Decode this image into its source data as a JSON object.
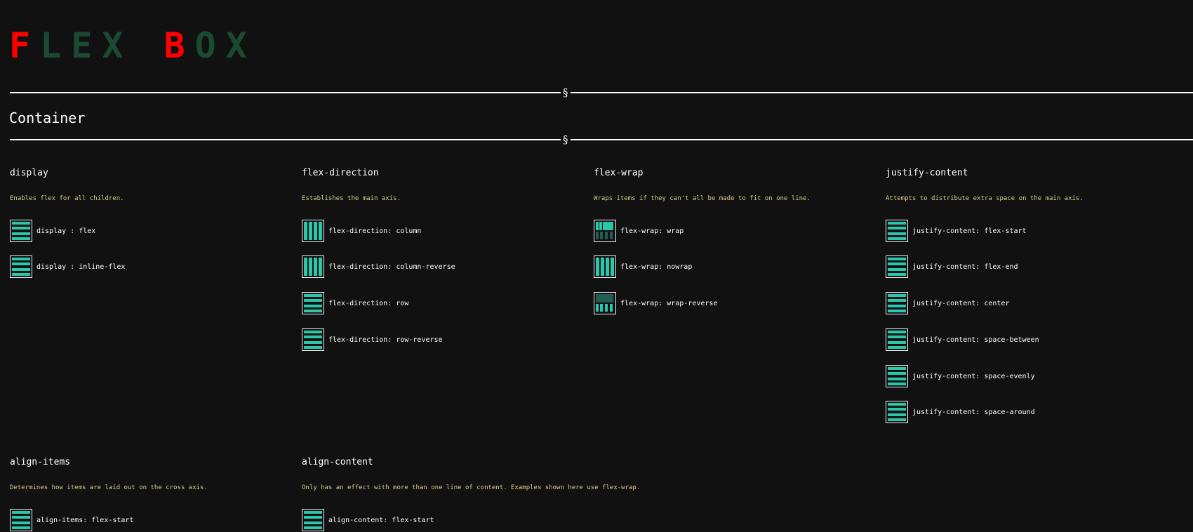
{
  "logo": {
    "f": "F",
    "lex": "LEX",
    "b": "B",
    "ox": "OX"
  },
  "section_mark": "§",
  "section_title": "Container",
  "accent_color": "#29c7ac",
  "logo_red": "#ff0000",
  "logo_green": "#1a4a32",
  "groups": {
    "display": {
      "title": "display",
      "desc": "Enables flex for all children.",
      "items": [
        "display : flex",
        "display : inline-flex"
      ]
    },
    "flex_direction": {
      "title": "flex-direction",
      "desc": "Establishes the main axis.",
      "items": [
        "flex-direction: column",
        "flex-direction: column-reverse",
        "flex-direction: row",
        "flex-direction: row-reverse"
      ]
    },
    "flex_wrap": {
      "title": "flex-wrap",
      "desc": "Wraps items if they can't all be made to fit on one line.",
      "items": [
        "flex-wrap: wrap",
        "flex-wrap: nowrap",
        "flex-wrap: wrap-reverse"
      ]
    },
    "justify_content": {
      "title": "justify-content",
      "desc": "Attempts to distribute extra space on the main axis.",
      "items": [
        "justify-content: flex-start",
        "justify-content: flex-end",
        "justify-content: center",
        "justify-content: space-between",
        "justify-content: space-evenly",
        "justify-content: space-around"
      ]
    },
    "align_items": {
      "title": "align-items",
      "desc": "Determines how items are laid out on the cross axis.",
      "items": [
        "align-items: flex-start"
      ]
    },
    "align_content": {
      "title": "align-content",
      "desc": "Only has an effect with more than one line of content. Examples shown here use flex-wrap.",
      "items": [
        "align-content: flex-start"
      ]
    }
  }
}
